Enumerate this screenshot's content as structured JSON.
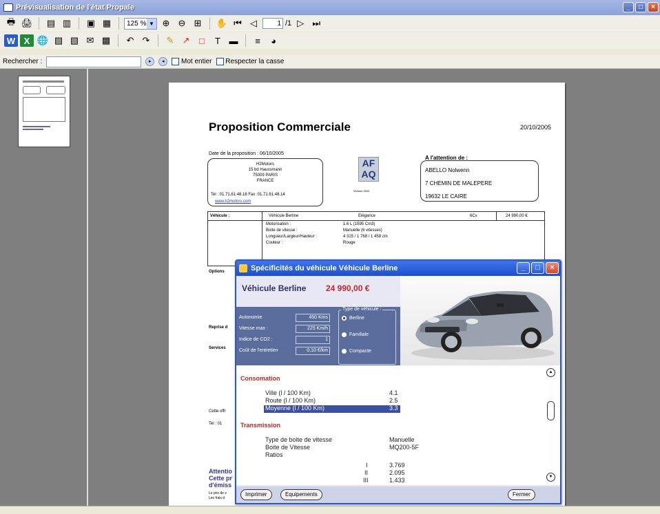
{
  "window": {
    "title": "Prévisualisation de l'état Propale"
  },
  "toolbar": {
    "zoom": "125 %",
    "page_current": "1",
    "page_total": "/1"
  },
  "search": {
    "label": "Rechercher :",
    "whole_word": "Mot entier",
    "match_case": "Respecter la casse"
  },
  "document": {
    "title": "Proposition Commerciale",
    "date": "20/10/2005",
    "proposal_date": "Date de la proposition :  06/10/2005",
    "sender": {
      "name": "H2Motors",
      "address1": "15 bd Haussmann",
      "address2": "75009 PARIS",
      "country": "FRANCE",
      "phone": "Tel : 01.71.61.48.16   Fax :01.71.61.48.14",
      "website": "www.h2motors.com"
    },
    "logo_text": "AF AQ",
    "logo_caption": "Version 2000",
    "attention": {
      "title": "A l'attention de :",
      "name": "ABELLO Nolwenn",
      "street": "7 CHEMIN DE MALEPERE",
      "city": "19632     LE CAIRE"
    },
    "vehicle_table": {
      "label": "Véhicule :",
      "model": "Véhicule Berline",
      "finish": "Elégance",
      "power": "6Cv",
      "price": "24 990,00 €",
      "details_labels": [
        "Motorisation :",
        "Boite de vitesse :",
        "Longueur/Largeur/Hauteur :",
        "Couleur :"
      ],
      "details_values": [
        "1.6 L (1595 Cm3)",
        "Manuelle (6 vitesses)",
        "4 315 / 1 768 / 1 458 cm",
        "Rouge"
      ]
    },
    "side_labels": [
      "Options",
      "Reprise d",
      "Services"
    ],
    "footer_lines": [
      "Cette offr",
      "Tel :   01"
    ],
    "purple_lines": [
      "Attentio",
      "Cette pr",
      "d'émiss"
    ],
    "small_lines": [
      "Le prix de v",
      "Les frais d"
    ]
  },
  "dialog": {
    "title": "Spécificités du véhicule Véhicule Berline",
    "vehicle_name": "Véhicule Berline",
    "price": "24 990,00 €",
    "specs": [
      {
        "label": "Autonomie",
        "value": "450 Kms"
      },
      {
        "label": "Vitesse max :",
        "value": "225 Km/h"
      },
      {
        "label": "Indice de CO2 :",
        "value": "1"
      },
      {
        "label": "Coût de l'entretien",
        "value": "0,10 €/km"
      }
    ],
    "type_title": "Type de véhicule :",
    "types": [
      "Berline",
      "Familiale",
      "Compacte"
    ],
    "selected_type": "Berline",
    "consommation_title": "Consomation",
    "consommation": [
      {
        "label": "Ville (l / 100 Km)",
        "value": "4.1"
      },
      {
        "label": "Route (l / 100 Km)",
        "value": "2.5"
      },
      {
        "label": "Moyenne (l / 100 Km)",
        "value": "3.3"
      }
    ],
    "transmission_title": "Transmission",
    "transmission": [
      {
        "label": "Type de boite de vitesse",
        "value": "Manuelle"
      },
      {
        "label": "Boite de Vitesse",
        "value": "MQ200-5F"
      },
      {
        "label": "Ratios",
        "value": ""
      }
    ],
    "ratios": [
      {
        "gear": "I",
        "value": "3.769"
      },
      {
        "gear": "II",
        "value": "2.095"
      },
      {
        "gear": "III",
        "value": "1.433"
      }
    ],
    "buttons": {
      "print": "Imprimer",
      "equipment": "Equipements",
      "close": "Fermer"
    }
  },
  "colors": {
    "accent": "#2a57d6",
    "price": "#cc2222",
    "section": "#b02a2a"
  }
}
